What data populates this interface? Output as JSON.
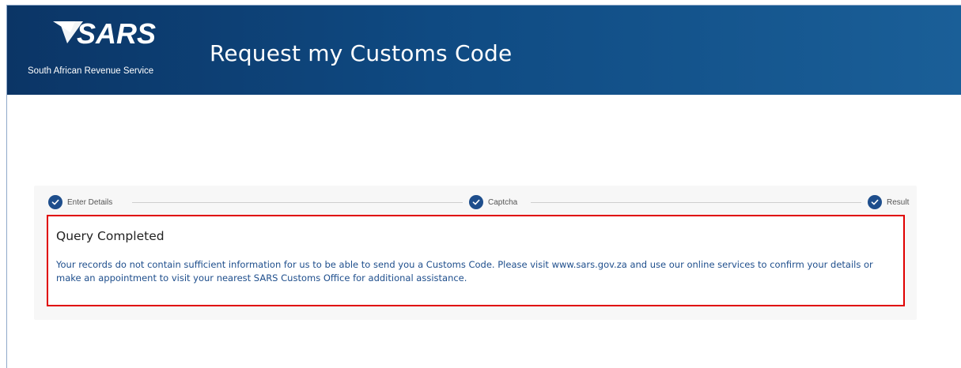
{
  "header": {
    "logo_text": "SARS",
    "tagline": "South African Revenue Service",
    "title": "Request my Customs Code"
  },
  "stepper": {
    "steps": [
      {
        "label": "Enter Details",
        "completed": true
      },
      {
        "label": "Captcha",
        "completed": true
      },
      {
        "label": "Result",
        "completed": true
      }
    ]
  },
  "result": {
    "heading": "Query Completed",
    "message": "Your records do not contain sufficient information for us to be able to send you a Customs Code.  Please visit www.sars.gov.za and use our online services to confirm your details or make an appointment to visit your nearest SARS Customs Office for additional assistance."
  },
  "colors": {
    "header_bg": "#0f4a82",
    "step_check": "#1e4e8c",
    "message_text": "#1e4e8c",
    "highlight_border": "#e00000"
  },
  "icons": {
    "logo": "sars-logo",
    "step_state": "check-circle-icon"
  }
}
